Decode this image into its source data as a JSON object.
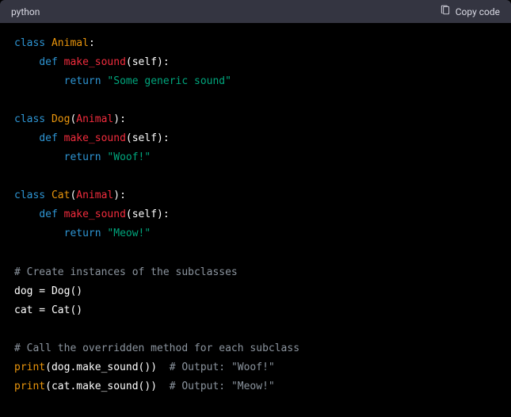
{
  "header": {
    "language": "python",
    "copy_label": "Copy code"
  },
  "code": {
    "kw_class": "class",
    "kw_def": "def",
    "kw_return": "return",
    "cls_animal": "Animal",
    "cls_dog": "Dog",
    "cls_cat": "Cat",
    "fn_make_sound": "make_sound",
    "self": "self",
    "str_generic": "\"Some generic sound\"",
    "str_woof": "\"Woof!\"",
    "str_meow": "\"Meow!\"",
    "cmt_inst": "# Create instances of the subclasses",
    "assign_dog": "dog = Dog()",
    "assign_cat": "cat = Cat()",
    "cmt_call": "# Call the overridden method for each subclass",
    "bi_print": "print",
    "call_dog": "(dog.make_sound())",
    "call_cat": "(cat.make_sound())",
    "cmt_out_woof": "# Output: \"Woof!\"",
    "cmt_out_meow": "# Output: \"Meow!\""
  }
}
